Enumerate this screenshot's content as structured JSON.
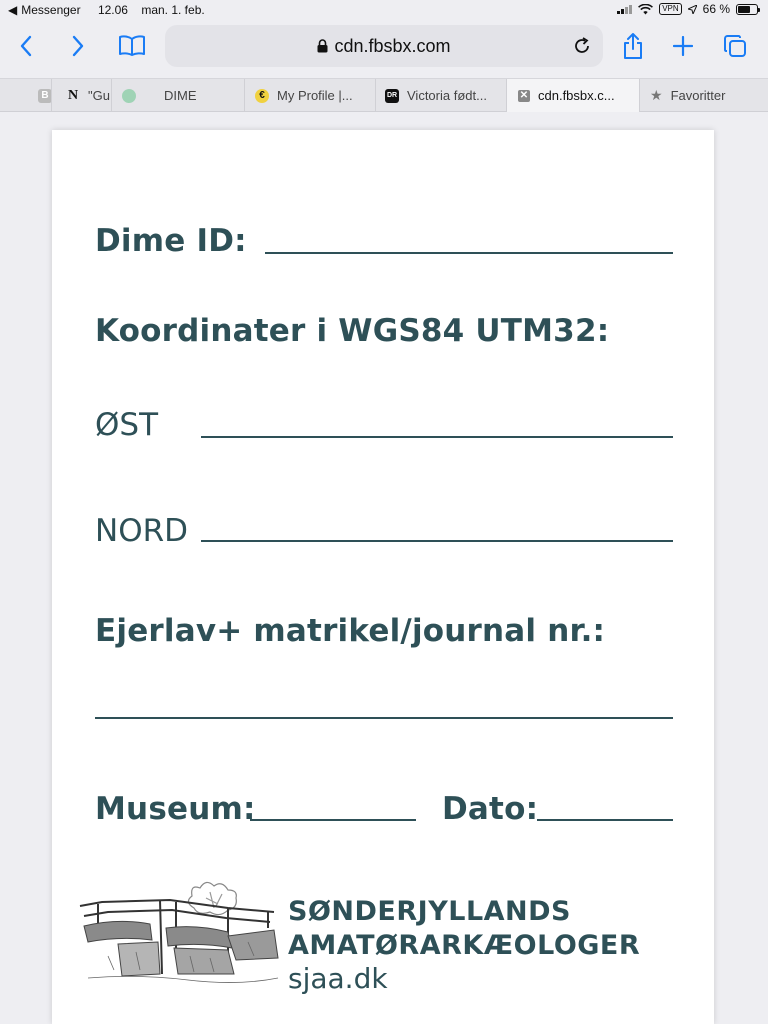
{
  "status_bar": {
    "back_app": "Messenger",
    "time": "12.06",
    "date": "man. 1. feb.",
    "vpn": "VPN",
    "battery": "66 %",
    "battery_level": 0.66
  },
  "toolbar": {
    "url": "cdn.fbsbx.com"
  },
  "tabs": [
    {
      "label": "",
      "icon": "generic-icon"
    },
    {
      "label": "\"Gu",
      "icon": "n-icon"
    },
    {
      "label": "DIME",
      "icon": "dime-icon"
    },
    {
      "label": "My Profile |...",
      "icon": "profile-icon"
    },
    {
      "label": "Victoria født...",
      "icon": "dr-icon"
    },
    {
      "label": "cdn.fbsbx.c...",
      "icon": "close-icon"
    },
    {
      "label": "Favoritter",
      "icon": "star-icon"
    }
  ],
  "document": {
    "dime_id_label": "Dime ID:",
    "coords_heading": "Koordinater i WGS84 UTM32:",
    "east_label": "ØST",
    "north_label": "NORD",
    "ejerlav_label": "Ejerlav+ matrikel/journal nr.:",
    "museum_label": "Museum:",
    "dato_label": "Dato:",
    "logo_line1": "SØNDERJYLLANDS",
    "logo_line2": "AMATØRARKÆOLOGER",
    "logo_url": "sjaa.dk"
  },
  "colors": {
    "accent": "#1a7cf5",
    "form_text": "#2e5057"
  }
}
